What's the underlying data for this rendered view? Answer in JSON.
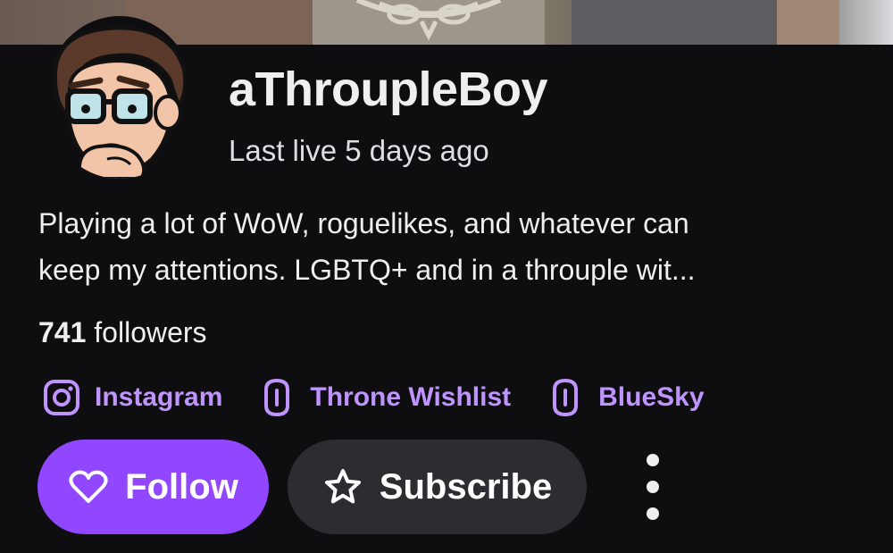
{
  "channel": {
    "name": "aThroupleBoy",
    "last_live": "Last live 5 days ago",
    "bio_line_1": "Playing a lot of WoW, roguelikes, and whatever can",
    "bio_line_2": "keep my attentions. LGBTQ+ and in a throuple wit...",
    "followers_count": "741",
    "followers_label": "followers"
  },
  "links": [
    {
      "label": "Instagram",
      "icon": "instagram-icon"
    },
    {
      "label": "Throne Wishlist",
      "icon": "link-icon"
    },
    {
      "label": "BlueSky",
      "icon": "link-icon"
    }
  ],
  "actions": {
    "follow_label": "Follow",
    "follow_icon": "heart-icon",
    "subscribe_label": "Subscribe",
    "subscribe_icon": "star-icon",
    "more_icon": "more-vertical-icon"
  },
  "colors": {
    "background": "#0e0e10",
    "accent": "#9147ff",
    "link": "#bf94ff",
    "secondary_button": "#2c2c31",
    "text": "#efeff1"
  }
}
